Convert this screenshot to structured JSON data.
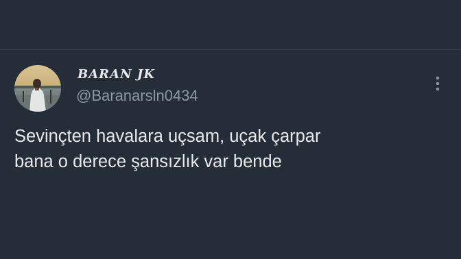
{
  "tweet": {
    "author": {
      "display_name": "BARAN JK",
      "handle": "@Baranarsln0434",
      "avatar_icon": "profile-photo"
    },
    "text_lines": [
      "Sevinçten havalara uçsam, uçak çarpar",
      "bana o derece şansızlık var bende"
    ],
    "more_icon": "more-vertical-icon"
  },
  "colors": {
    "background": "#252d38",
    "primary_text": "#e7e9ea",
    "secondary_text": "#8b98a5",
    "divider": "#3a4350"
  }
}
